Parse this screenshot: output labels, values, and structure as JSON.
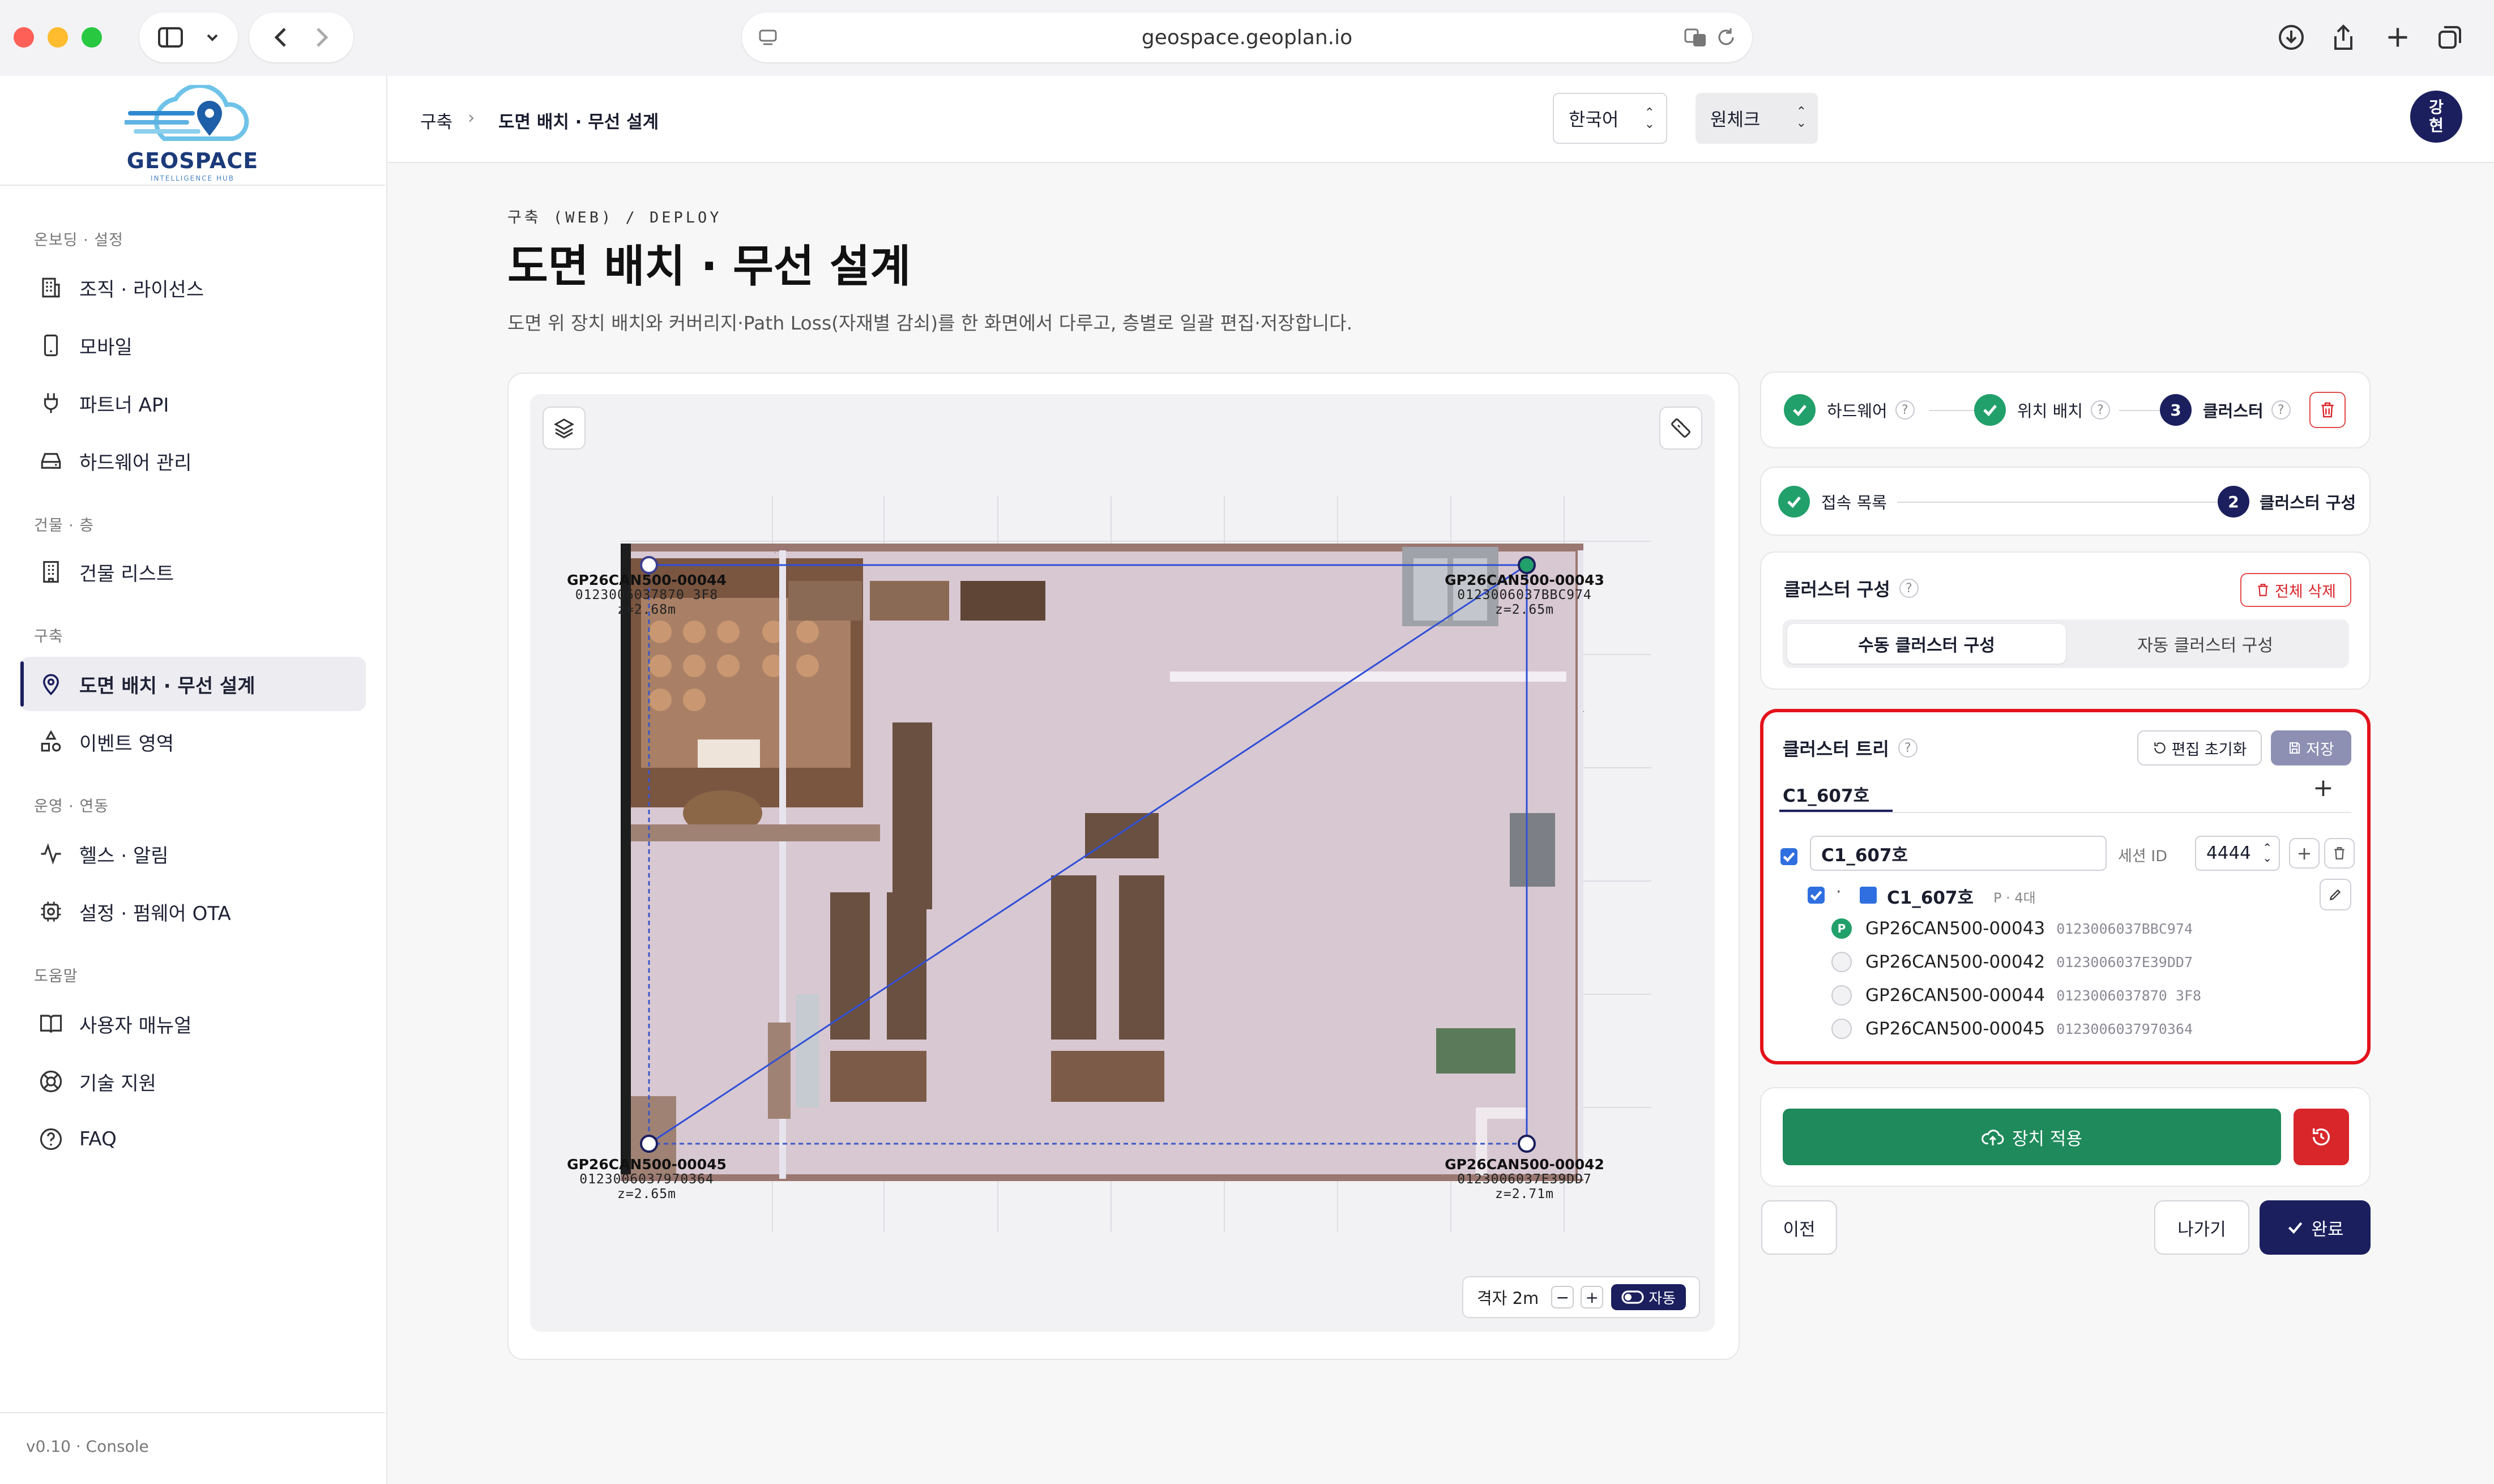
{
  "browser": {
    "url": "geospace.geoplan.io"
  },
  "brand": {
    "name": "GEOSPACE",
    "tagline": "INTELLIGENCE HUB"
  },
  "sidebar": {
    "sections": [
      {
        "title": "온보딩 · 설정",
        "items": [
          {
            "label": "조직 · 라이선스",
            "icon": "building-icon"
          },
          {
            "label": "모바일",
            "icon": "mobile-icon"
          },
          {
            "label": "파트너 API",
            "icon": "plug-icon"
          },
          {
            "label": "하드웨어 관리",
            "icon": "hard-drive-icon"
          }
        ]
      },
      {
        "title": "건물 · 층",
        "items": [
          {
            "label": "건물 리스트",
            "icon": "building-list-icon"
          }
        ]
      },
      {
        "title": "구축",
        "items": [
          {
            "label": "도면 배치 · 무선 설계",
            "icon": "map-pin-icon",
            "active": true
          },
          {
            "label": "이벤트 영역",
            "icon": "shapes-icon"
          }
        ]
      },
      {
        "title": "운영 · 연동",
        "items": [
          {
            "label": "헬스 · 알림",
            "icon": "activity-icon"
          },
          {
            "label": "설정 · 펌웨어 OTA",
            "icon": "settings-chip-icon"
          }
        ]
      },
      {
        "title": "도움말",
        "items": [
          {
            "label": "사용자 매뉴얼",
            "icon": "book-icon"
          },
          {
            "label": "기술 지원",
            "icon": "lifebuoy-icon"
          },
          {
            "label": "FAQ",
            "icon": "help-circle-icon"
          }
        ]
      }
    ],
    "version": "v0.10 · Console"
  },
  "topbar": {
    "breadcrumb": [
      "구축",
      "도면 배치 · 무선 설계"
    ],
    "language": "한국어",
    "project": "원체크",
    "avatar": "강\n현"
  },
  "page": {
    "eyebrow": "구축 (WEB) / DEPLOY",
    "title": "도면 배치 · 무선 설계",
    "description": "도면 위 장치 배치와 커버리지·Path Loss(자재별 감쇠)를 한 화면에서 다루고, 층별로 일괄 편집·저장합니다."
  },
  "map": {
    "devices": [
      {
        "name": "GP26CAN500-00044",
        "mac": "0123006037870 3F8",
        "z": "z=2.68m"
      },
      {
        "name": "GP26CAN500-00043",
        "mac": "0123006037BBC974",
        "z": "z=2.65m"
      },
      {
        "name": "GP26CAN500-00045",
        "mac": "0123006037970364",
        "z": "z=2.65m"
      },
      {
        "name": "GP26CAN500-00042",
        "mac": "0123006037E39DD7",
        "z": "z=2.71m"
      }
    ],
    "grid_label": "격자 2m",
    "auto_label": "자동"
  },
  "wizard": {
    "steps": [
      {
        "label": "하드웨어",
        "state": "done"
      },
      {
        "label": "위치 배치",
        "state": "done"
      },
      {
        "label": "클러스터",
        "state": "current",
        "num": "3"
      }
    ],
    "substeps": [
      {
        "label": "접속 목록",
        "state": "done"
      },
      {
        "label": "클러스터 구성",
        "state": "current",
        "num": "2"
      }
    ]
  },
  "cluster_config": {
    "title": "클러스터 구성",
    "delete_all": "전체 삭제",
    "modes": [
      "수동 클러스터 구성",
      "자동 클러스터 구성"
    ],
    "active_mode": 0
  },
  "cluster_tree": {
    "title": "클러스터 트리",
    "reset_label": "편집 초기화",
    "save_label": "저장",
    "tab": "C1_607호",
    "cluster_name": "C1_607호",
    "session_label": "세션 ID",
    "session_id": "4444",
    "group": {
      "name": "C1_607호",
      "meta": "P · 4대",
      "color": "#2f6fe0"
    },
    "devices": [
      {
        "name": "GP26CAN500-00043",
        "mac": "0123006037BBC974",
        "primary": true,
        "badge": "P"
      },
      {
        "name": "GP26CAN500-00042",
        "mac": "0123006037E39DD7",
        "primary": false
      },
      {
        "name": "GP26CAN500-00044",
        "mac": "0123006037870 3F8",
        "primary": false
      },
      {
        "name": "GP26CAN500-00045",
        "mac": "0123006037970364",
        "primary": false
      }
    ]
  },
  "actions": {
    "apply_label": "장치 적용",
    "prev_label": "이전",
    "exit_label": "나가기",
    "done_label": "완료"
  },
  "colors": {
    "navy": "#1b1f5e",
    "green": "#1f8a5b",
    "red": "#d8262b",
    "highlight": "#e3121b"
  }
}
